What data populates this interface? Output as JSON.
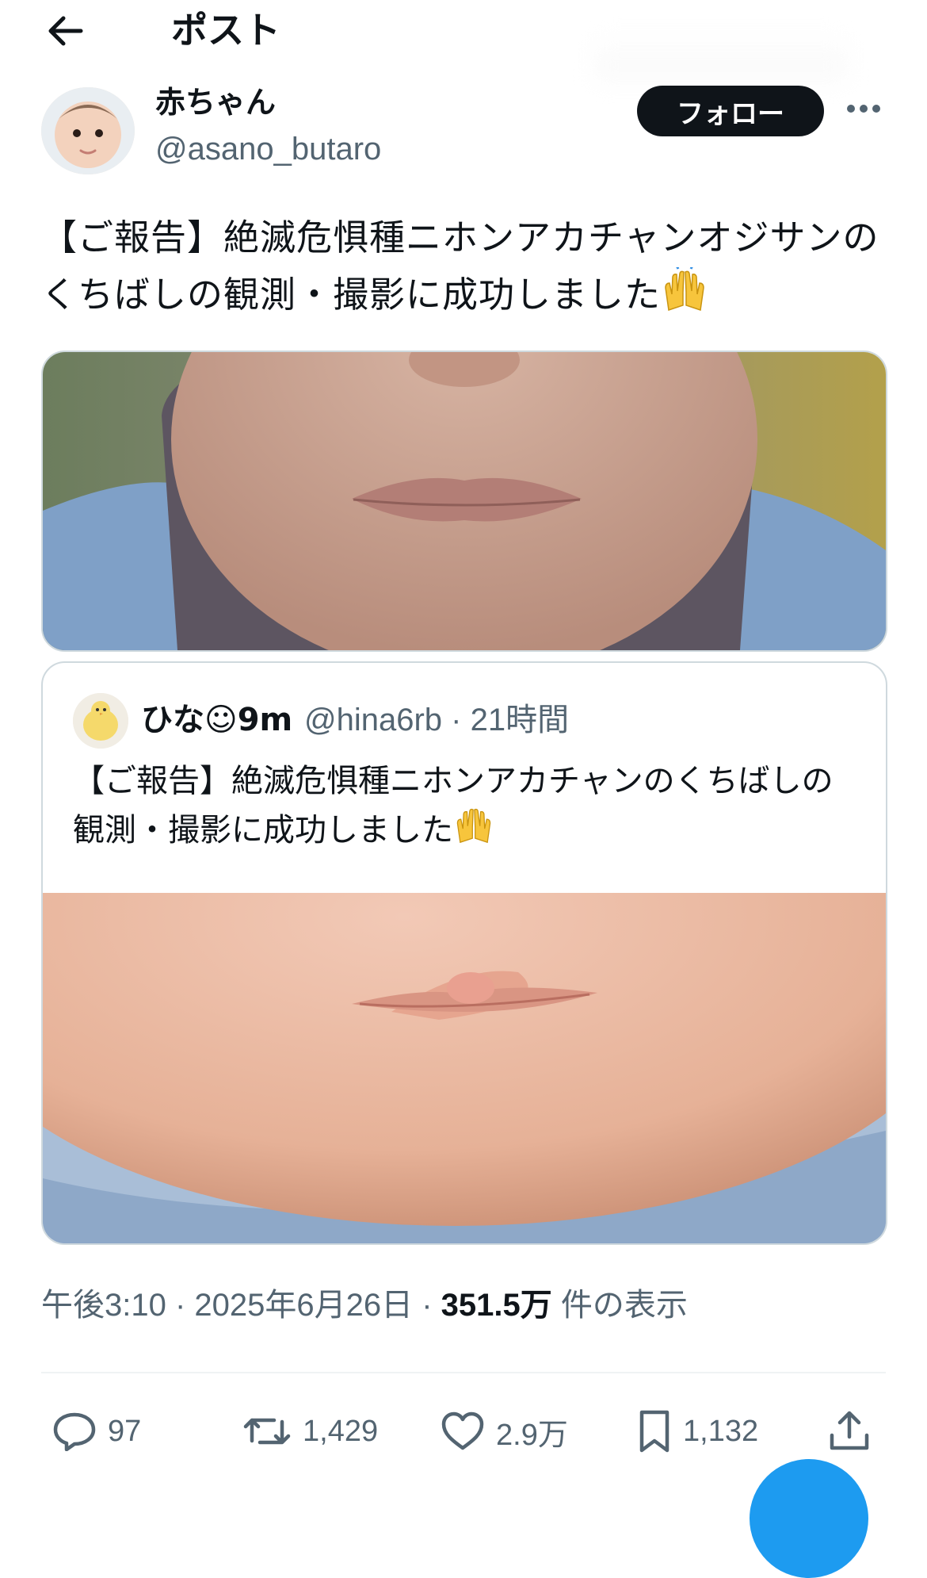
{
  "header": {
    "title": "ポスト",
    "back_icon": "arrow-left-icon"
  },
  "author": {
    "display_name": "赤ちゃん",
    "handle": "@asano_butaro",
    "follow_label": "フォロー",
    "more_icon": "more-horizontal-icon"
  },
  "post": {
    "text": "【ご報告】絶滅危惧種ニホンアカチャンオジサンのくちばしの観測・撮影に成功しました",
    "emoji": "🙌"
  },
  "quote": {
    "display_name": "ひな☺9m",
    "handle": "@hina6rb · 21時間",
    "text": "【ご報告】絶滅危惧種ニホンアカチャンのくちばしの観測・撮影に成功しました",
    "emoji": "🙌"
  },
  "meta": {
    "time": "午後3:10 · 2025年6月26日 · ",
    "views": "351.5万",
    "views_suffix": " 件の表示"
  },
  "actions": {
    "replies": "97",
    "reposts": "1,429",
    "likes": "2.9万",
    "bookmarks": "1,132"
  },
  "colors": {
    "accent": "#1d9bf0",
    "text": "#0f1419",
    "muted": "#536471",
    "border": "#cfd9de"
  }
}
